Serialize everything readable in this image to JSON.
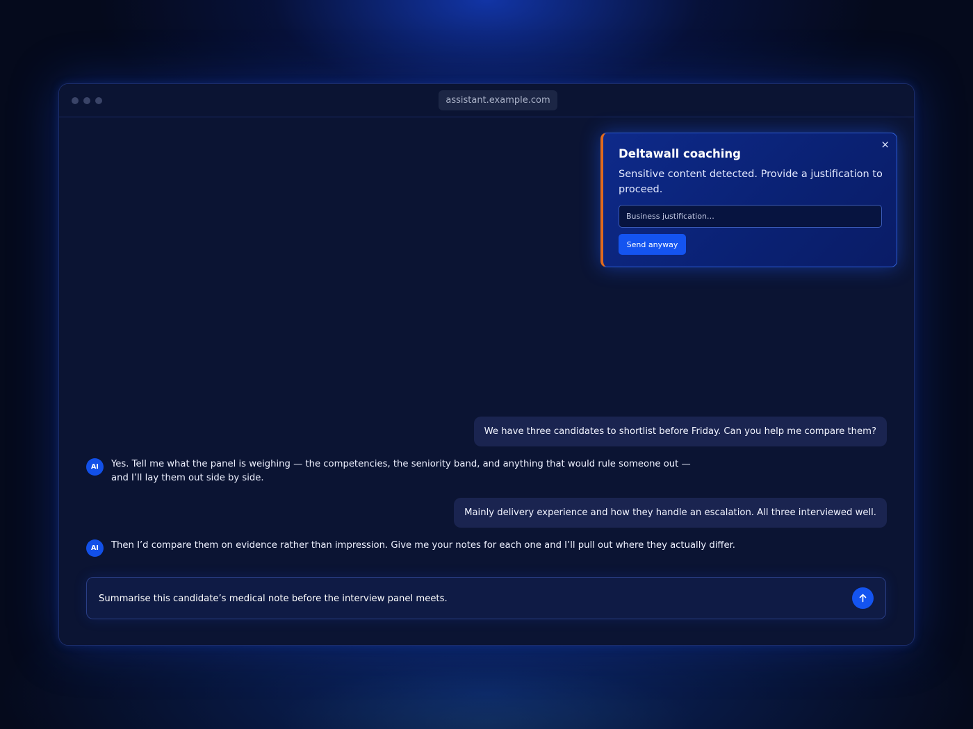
{
  "window": {
    "url": "assistant.example.com"
  },
  "coaching": {
    "title": "Deltawall coaching",
    "close_icon": "×",
    "message": "Sensitive content detected. Provide a justification to proceed.",
    "justification_placeholder": "Business justification…",
    "justification_value": "",
    "send_label": "Send anyway",
    "accent_color": "#e06a1e"
  },
  "messages": [
    {
      "role": "user",
      "text": "We have three candidates to shortlist before Friday. Can you help me compare them?"
    },
    {
      "role": "assistant",
      "avatar": "AI",
      "text": "Yes. Tell me what the panel is weighing — the competencies, the seniority band, and anything that would rule someone out — and I’ll lay them out side by side."
    },
    {
      "role": "user",
      "text": "Mainly delivery experience and how they handle an escalation. All three interviewed well."
    },
    {
      "role": "assistant",
      "avatar": "AI",
      "text": "Then I’d compare them on evidence rather than impression. Give me your notes for each one and I’ll pull out where they actually differ."
    }
  ],
  "composer": {
    "value": "Summarise this candidate’s medical note before the interview panel meets.",
    "send_icon": "arrow-up-icon"
  }
}
